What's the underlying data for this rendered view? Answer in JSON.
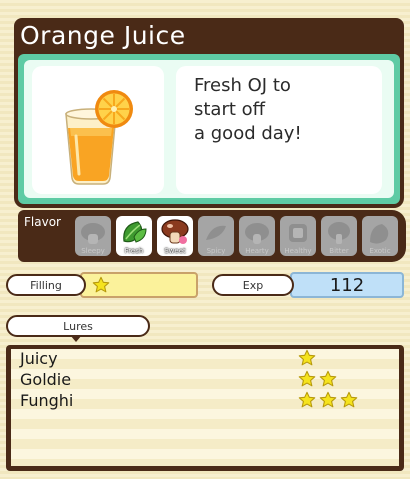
{
  "item": {
    "name": "Orange Juice",
    "description_lines": [
      "Fresh OJ to",
      "start off",
      "a good day!"
    ]
  },
  "flavor": {
    "label": "Flavor",
    "tiles": [
      {
        "name": "Sleepy",
        "active": false,
        "icon": "sleepy-mushroom-icon"
      },
      {
        "name": "Fresh",
        "active": true,
        "icon": "fresh-leaf-icon"
      },
      {
        "name": "Sweet",
        "active": true,
        "icon": "sweet-mushroom-icon"
      },
      {
        "name": "Spicy",
        "active": false,
        "icon": "spicy-icon"
      },
      {
        "name": "Hearty",
        "active": false,
        "icon": "hearty-icon"
      },
      {
        "name": "Healthy",
        "active": false,
        "icon": "healthy-icon"
      },
      {
        "name": "Bitter",
        "active": false,
        "icon": "bitter-icon"
      },
      {
        "name": "Exotic",
        "active": false,
        "icon": "exotic-icon"
      }
    ]
  },
  "filling": {
    "label": "Filling",
    "stars": 1
  },
  "exp": {
    "label": "Exp",
    "value": "112"
  },
  "lures": {
    "label": "Lures",
    "items": [
      {
        "name": "Juicy",
        "stars": 1
      },
      {
        "name": "Goldie",
        "stars": 2
      },
      {
        "name": "Funghi",
        "stars": 3
      }
    ]
  },
  "colors": {
    "frame": "#4a2a17",
    "card": "#5ecba4",
    "star": "#f5e31d"
  }
}
